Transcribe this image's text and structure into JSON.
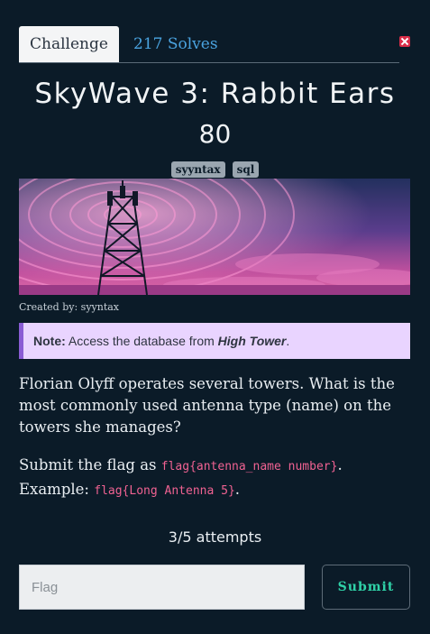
{
  "tabs": {
    "challenge": "Challenge",
    "solves": "217 Solves"
  },
  "challenge": {
    "title": "SkyWave 3: Rabbit Ears",
    "points": "80",
    "tags": [
      "syyntax",
      "sql"
    ],
    "created_by": "Created by: syyntax"
  },
  "note": {
    "label": "Note:",
    "text": "Access the database from",
    "target": "High Tower",
    "end": "."
  },
  "description": "Florian Olyff operates several towers. What is the most commonly used antenna type (name) on the towers she manages?",
  "submit_info": {
    "prefix": "Submit the flag as",
    "format": "flag{antenna_name number}",
    "mid": ". Example:",
    "example": "flag{Long Antenna 5}",
    "end": "."
  },
  "attempts": "3/5 attempts",
  "form": {
    "placeholder": "Flag",
    "submit_label": "Submit"
  },
  "colors": {
    "background": "#0b1b28",
    "accent": "#2fd1a7",
    "link": "#4aa3df",
    "note_bg": "#e9d4ff"
  }
}
